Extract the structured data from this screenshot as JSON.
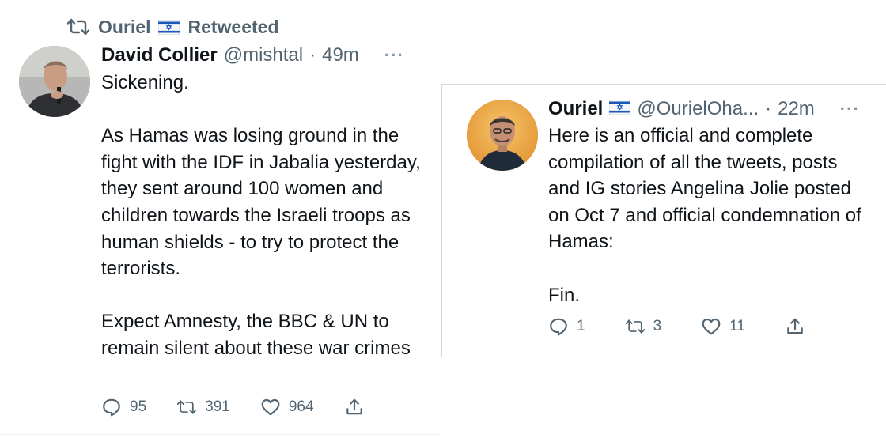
{
  "left_tweet": {
    "retweeted_by": "Ouriel",
    "retweeted_label": "Retweeted",
    "display_name": "David Collier",
    "handle": "@mishtal",
    "separator": "·",
    "time": "49m",
    "more": "···",
    "text": "Sickening.\n\nAs Hamas was losing ground in the fight with the IDF in Jabalia yesterday, they sent around 100 women and children towards the Israeli troops as human shields - to try to protect the terrorists.\n\nExpect Amnesty, the BBC & UN to remain silent about these war crimes",
    "replies": "95",
    "retweets": "391",
    "likes": "964"
  },
  "right_tweet": {
    "display_name": "Ouriel",
    "handle": "@OurielOha...",
    "separator": "·",
    "time": "22m",
    "more": "···",
    "text": "Here is an official and complete compilation of all the tweets, posts and IG stories Angelina Jolie posted on Oct 7 and official condemnation of Hamas:\n\nFin.",
    "replies": "1",
    "retweets": "3",
    "likes": "11"
  },
  "icons": {
    "retweet": "retweet-icon",
    "reply": "reply-icon",
    "like": "heart-icon",
    "share": "share-icon",
    "flag": "israel-flag-icon"
  },
  "colors": {
    "text": "#0f1419",
    "muted": "#536471",
    "border": "#cfd9de",
    "flag_blue": "#1a57b8"
  }
}
